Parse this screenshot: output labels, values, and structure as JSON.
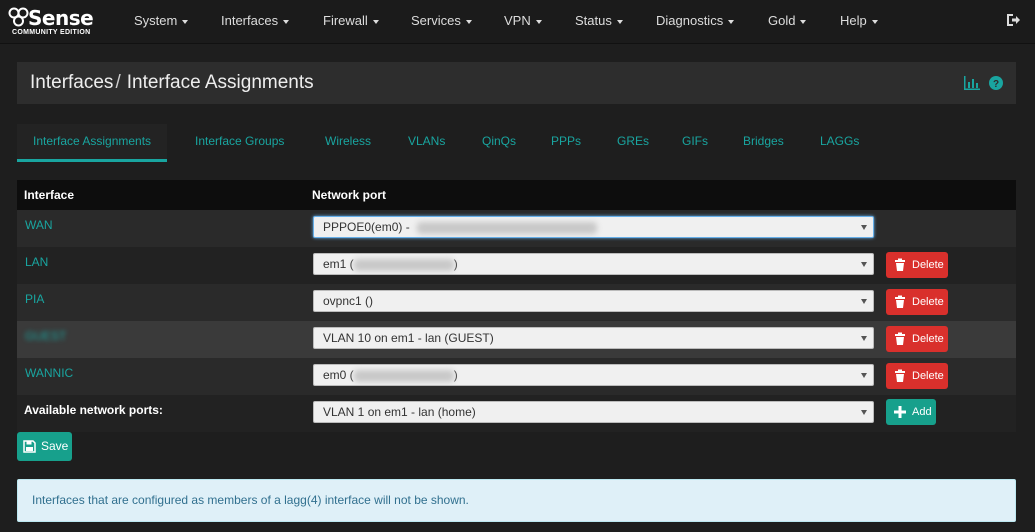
{
  "brand": {
    "logo_text": "Sense",
    "logo_prefix": "pf",
    "subtitle": "COMMUNITY EDITION"
  },
  "nav": [
    {
      "label": "System"
    },
    {
      "label": "Interfaces"
    },
    {
      "label": "Firewall"
    },
    {
      "label": "Services"
    },
    {
      "label": "VPN"
    },
    {
      "label": "Status"
    },
    {
      "label": "Diagnostics"
    },
    {
      "label": "Gold"
    },
    {
      "label": "Help"
    }
  ],
  "breadcrumb": {
    "parent": "Interfaces",
    "separator": "/",
    "current": "Interface Assignments"
  },
  "tabs": [
    {
      "label": "Interface Assignments"
    },
    {
      "label": "Interface Groups"
    },
    {
      "label": "Wireless"
    },
    {
      "label": "VLANs"
    },
    {
      "label": "QinQs"
    },
    {
      "label": "PPPs"
    },
    {
      "label": "GREs"
    },
    {
      "label": "GIFs"
    },
    {
      "label": "Bridges"
    },
    {
      "label": "LAGGs"
    }
  ],
  "table": {
    "col_interface": "Interface",
    "col_port": "Network port",
    "rows": [
      {
        "name": "WAN",
        "port": "PPPOE0(em0) -",
        "has_delete": false,
        "blurred_name": false
      },
      {
        "name": "LAN",
        "port": "em1 (",
        "port_suffix": ")",
        "has_delete": true,
        "blurred_name": false
      },
      {
        "name": "PIA",
        "port": "ovpnc1 ()",
        "has_delete": true,
        "blurred_name": false
      },
      {
        "name": "GUEST",
        "port": "VLAN 10 on em1 - lan (GUEST)",
        "has_delete": true,
        "blurred_name": true
      },
      {
        "name": "WANNIC",
        "port": "em0 (",
        "port_suffix": ")",
        "has_delete": true,
        "blurred_name": false
      }
    ],
    "delete_label": "Delete",
    "available_label": "Available network ports:",
    "available_value": "VLAN 1 on em1 - lan (home)",
    "add_label": "Add"
  },
  "save_label": "Save",
  "info_text": "Interfaces that are configured as members of a lagg(4) interface will not be shown.",
  "colors": {
    "accent": "#19a5a0",
    "danger": "#d9302c",
    "success": "#17a08c"
  }
}
